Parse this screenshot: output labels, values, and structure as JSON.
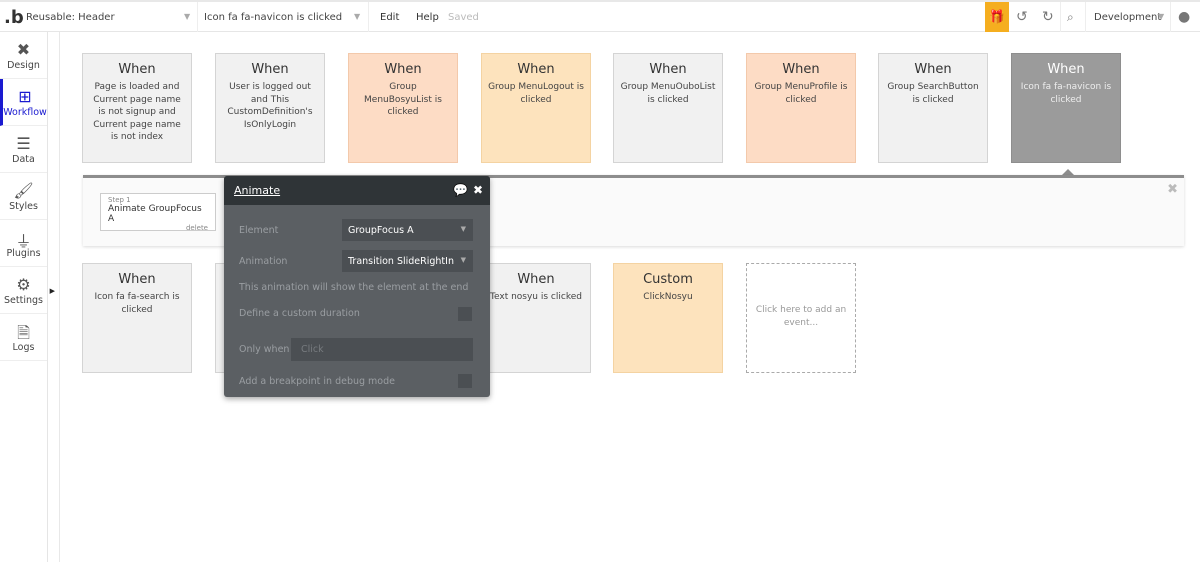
{
  "topbar": {
    "logo": ".b",
    "page": "Reusable: Header",
    "event": "Icon fa fa-navicon is clicked",
    "edit": "Edit",
    "help": "Help",
    "status": "Saved",
    "environment": "Development",
    "gift_color": "#f5ae1f"
  },
  "sidebar": {
    "items": [
      {
        "label": "Design",
        "icon": "design-icon"
      },
      {
        "label": "Workflow",
        "icon": "workflow-icon",
        "active": true
      },
      {
        "label": "Data",
        "icon": "database-icon"
      },
      {
        "label": "Styles",
        "icon": "brush-icon"
      },
      {
        "label": "Plugins",
        "icon": "plug-icon"
      },
      {
        "label": "Settings",
        "icon": "gear-icon"
      },
      {
        "label": "Logs",
        "icon": "file-icon"
      }
    ]
  },
  "events_row1": [
    {
      "title": "When",
      "text": "Page is loaded and Current page name is not signup and Current page name is not index"
    },
    {
      "title": "When",
      "text": "User is logged out and This CustomDefinition's IsOnlyLogin"
    },
    {
      "title": "When",
      "text": "Group MenuBosyuList is clicked"
    },
    {
      "title": "When",
      "text": "Group MenuLogout is clicked"
    },
    {
      "title": "When",
      "text": "Group MenuOuboList is clicked"
    },
    {
      "title": "When",
      "text": "Group MenuProfile is clicked"
    },
    {
      "title": "When",
      "text": "Group SearchButton is clicked"
    },
    {
      "title": "When",
      "text": "Icon fa fa-navicon is clicked"
    }
  ],
  "events_row2": [
    {
      "title": "When",
      "text": "Icon fa fa-search is clicked"
    },
    {
      "title": "When",
      "text": "Text nosyu is clicked"
    },
    {
      "title": "Custom",
      "text": "ClickNosyu"
    }
  ],
  "add_event": "Click here to add an event...",
  "workflow": {
    "step_number": "Step 1",
    "step_action": "Animate GroupFocus A",
    "delete": "delete"
  },
  "popup": {
    "title": "Animate",
    "element_label": "Element",
    "element_value": "GroupFocus A",
    "animation_label": "Animation",
    "animation_value": "Transition SlideRightIn",
    "note": "This animation will show the element at the end",
    "custom_duration": "Define a custom duration",
    "only_when": "Only when",
    "only_when_placeholder": "Click",
    "breakpoint": "Add a breakpoint in debug mode"
  }
}
